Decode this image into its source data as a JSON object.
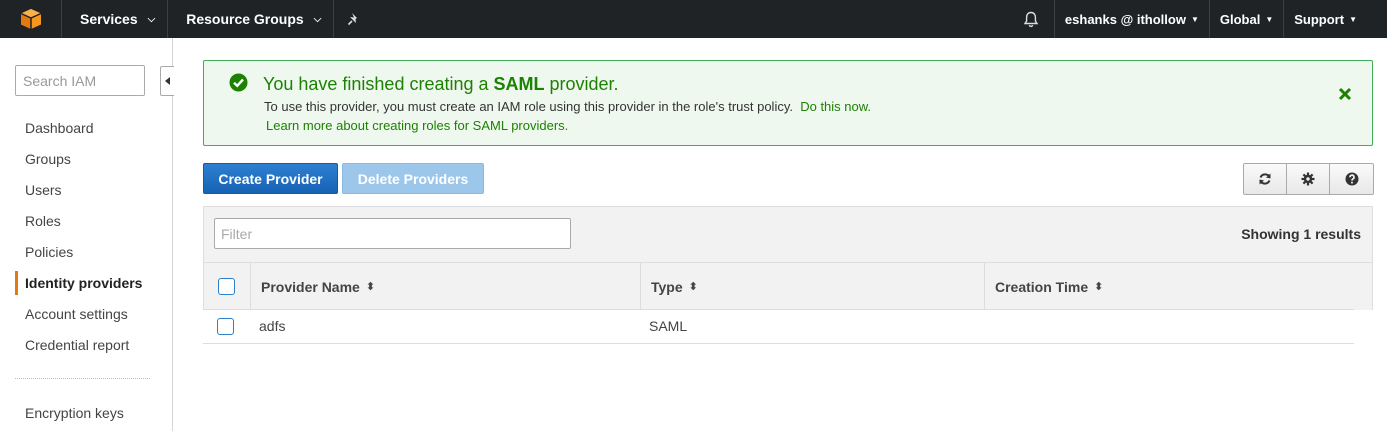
{
  "topnav": {
    "services_label": "Services",
    "resource_groups_label": "Resource Groups",
    "user_label": "eshanks @ ithollow",
    "region_label": "Global",
    "support_label": "Support"
  },
  "sidebar": {
    "search_placeholder": "Search IAM",
    "items": [
      {
        "label": "Dashboard"
      },
      {
        "label": "Groups"
      },
      {
        "label": "Users"
      },
      {
        "label": "Roles"
      },
      {
        "label": "Policies"
      },
      {
        "label": "Identity providers"
      },
      {
        "label": "Account settings"
      },
      {
        "label": "Credential report"
      },
      {
        "label": "Encryption keys"
      }
    ],
    "active_item": "Identity providers"
  },
  "alert": {
    "title_prefix": "You have finished creating a ",
    "title_bold": "SAML",
    "title_suffix": " provider.",
    "message": "To use this provider, you must create an IAM role using this provider in the role's trust policy.",
    "action_link": "Do this now.",
    "learn_more_link": "Learn more about creating roles for SAML providers."
  },
  "toolbar": {
    "create_label": "Create Provider",
    "delete_label": "Delete Providers"
  },
  "table": {
    "filter_placeholder": "Filter",
    "showing_text": "Showing 1 results",
    "columns": [
      "Provider Name",
      "Type",
      "Creation Time"
    ],
    "rows": [
      {
        "provider_name": "adfs",
        "type": "SAML",
        "creation_time": ""
      }
    ]
  },
  "colors": {
    "accent_orange": "#e47911",
    "success_green": "#1d8102",
    "primary_blue": "#1a6ec7",
    "nav_bg": "#1f2326"
  }
}
